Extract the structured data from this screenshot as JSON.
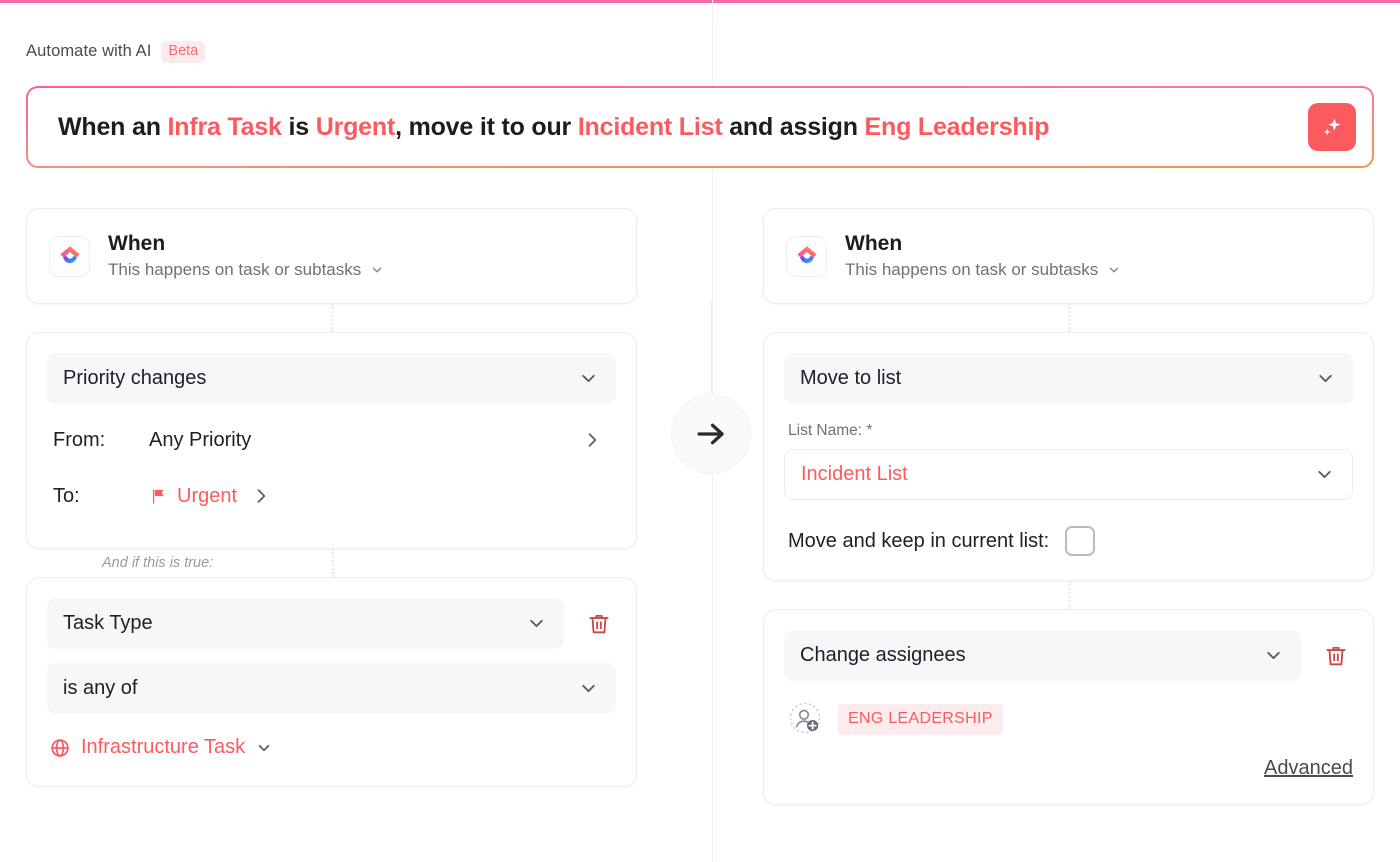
{
  "header": {
    "label": "Automate with AI",
    "badge": "Beta"
  },
  "prompt": {
    "segments": [
      {
        "text": "When an ",
        "highlight": false
      },
      {
        "text": "Infra Task",
        "highlight": true
      },
      {
        "text": " is ",
        "highlight": false
      },
      {
        "text": "Urgent",
        "highlight": true
      },
      {
        "text": ", move it to our ",
        "highlight": false
      },
      {
        "text": "Incident List",
        "highlight": true
      },
      {
        "text": " and assign ",
        "highlight": false
      },
      {
        "text": "Eng Leadership",
        "highlight": true
      }
    ],
    "plain_text": "When an Infra Task is Urgent, move it to our Incident List and assign Eng Leadership",
    "submit_icon": "sparkle-icon",
    "border_gradient_from": "#f75ca5",
    "border_gradient_to": "#f79348",
    "submit_color": "#fb5a5f"
  },
  "trigger": {
    "app_icon": "clickup-logo-icon",
    "title": "When",
    "subtitle": "This happens on task or subtasks",
    "subtitle_chevron": "chevron-down-icon"
  },
  "left_column": {
    "condition": {
      "event_select": "Priority changes",
      "event_chevron": "chevron-down-icon",
      "from_label": "From:",
      "from_value": "Any Priority",
      "to_label": "To:",
      "to_value": "Urgent",
      "to_flag_icon": "flag-icon",
      "row_chevron": "chevron-right-icon"
    },
    "and_if_true": "And if this is true:",
    "filter": {
      "field_select": "Task Type",
      "operator_select": "is any of",
      "value_chip": "Infrastructure Task",
      "value_icon": "globe-icon",
      "delete_icon": "trash-icon",
      "chevron": "chevron-down-icon"
    }
  },
  "right_column": {
    "move_action": {
      "action_select": "Move to list",
      "list_name_label": "List Name: *",
      "list_name_value": "Incident List",
      "keep_label": "Move and keep in current list:",
      "keep_checked": false,
      "chevron": "chevron-down-icon"
    },
    "assignee_action": {
      "action_select": "Change assignees",
      "assignee_chip": "ENG LEADERSHIP",
      "add_icon": "add-person-icon",
      "delete_icon": "trash-icon",
      "advanced_link": "Advanced",
      "chevron": "chevron-down-icon"
    }
  },
  "connector": {
    "arrow_icon": "arrow-right-icon"
  },
  "colors": {
    "accent_red": "#fb5a5f",
    "top_rule": "#f967a8",
    "muted_text": "#70707a",
    "control_bg": "#f6f7f9"
  }
}
